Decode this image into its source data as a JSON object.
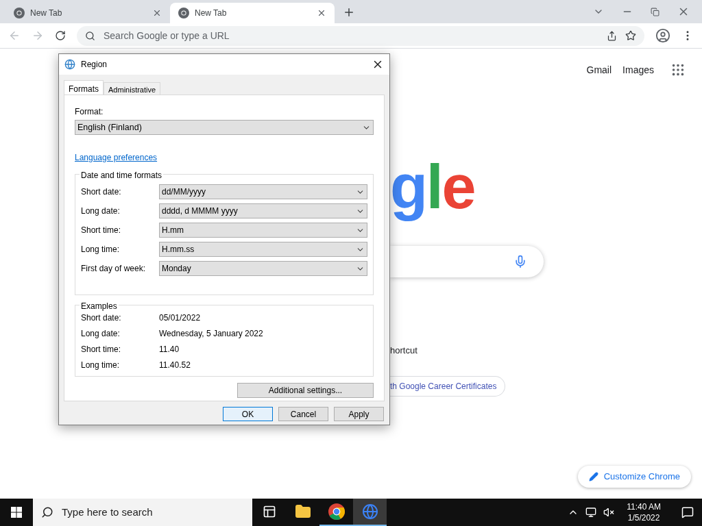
{
  "browser": {
    "tabs": [
      {
        "title": "New Tab",
        "selected": false
      },
      {
        "title": "New Tab",
        "selected": true
      }
    ],
    "omnibox": {
      "placeholder": "Search Google or type a URL"
    }
  },
  "page": {
    "header_links": [
      "Gmail",
      "Images"
    ],
    "logo_letters": [
      {
        "text": "g",
        "color": "#4285f4"
      },
      {
        "text": "l",
        "color": "#34a853"
      },
      {
        "text": "e",
        "color": "#ea4335"
      }
    ],
    "shortcut_label": "hortcut",
    "promo_chip": "th Google Career Certificates",
    "customize_button": "Customize Chrome"
  },
  "dialog": {
    "title": "Region",
    "tabs": [
      {
        "label": "Formats",
        "selected": true
      },
      {
        "label": "Administrative",
        "selected": false
      }
    ],
    "format_label": "Format:",
    "format_value": "English (Finland)",
    "link": "Language preferences",
    "formats_group": {
      "title": "Date and time formats",
      "rows": [
        {
          "label": "Short date:",
          "value": "dd/MM/yyyy"
        },
        {
          "label": "Long date:",
          "value": "dddd, d MMMM yyyy"
        },
        {
          "label": "Short time:",
          "value": "H.mm"
        },
        {
          "label": "Long time:",
          "value": "H.mm.ss"
        },
        {
          "label": "First day of week:",
          "value": "Monday"
        }
      ]
    },
    "examples_group": {
      "title": "Examples",
      "rows": [
        {
          "label": "Short date:",
          "value": "05/01/2022"
        },
        {
          "label": "Long date:",
          "value": "Wednesday, 5 January 2022"
        },
        {
          "label": "Short time:",
          "value": "11.40"
        },
        {
          "label": "Long time:",
          "value": "11.40.52"
        }
      ]
    },
    "additional_button": "Additional settings...",
    "buttons": [
      {
        "label": "OK",
        "default": true
      },
      {
        "label": "Cancel",
        "default": false
      },
      {
        "label": "Apply",
        "default": false
      }
    ]
  },
  "taskbar": {
    "search_placeholder": "Type here to search",
    "apps": [
      {
        "kind": "taskview",
        "open": false,
        "selected": false
      },
      {
        "kind": "explorer",
        "open": false,
        "selected": false
      },
      {
        "kind": "chrome",
        "open": true,
        "selected": false
      },
      {
        "kind": "region",
        "open": true,
        "selected": true
      }
    ],
    "time": "11:40 AM",
    "date": "1/5/2022"
  }
}
